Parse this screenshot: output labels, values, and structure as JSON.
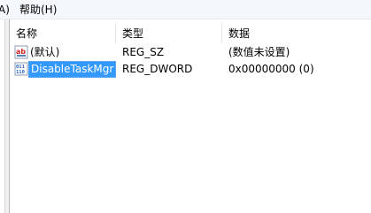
{
  "menubar": {
    "partial_item": "A)",
    "help": "帮助(H)"
  },
  "columns": {
    "name": "名称",
    "type": "类型",
    "data": "数据"
  },
  "rows": [
    {
      "name": "(默认)",
      "type": "REG_SZ",
      "data": "(数值未设置)",
      "icon": "string-value-icon",
      "selected": false
    },
    {
      "name": "DisableTaskMgr",
      "type": "REG_DWORD",
      "data": "0x00000000 (0)",
      "icon": "binary-value-icon",
      "selected": true
    }
  ],
  "colors": {
    "selection": "#3399ff",
    "menubar_bg": "#f4f7fc"
  }
}
